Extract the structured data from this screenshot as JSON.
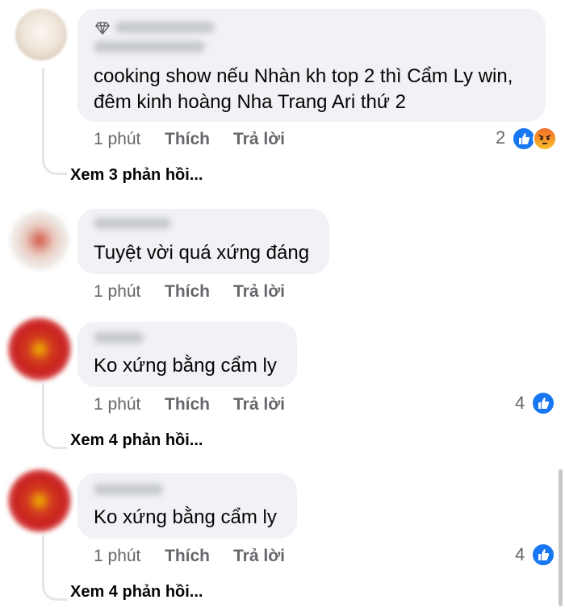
{
  "colors": {
    "like_blue": "#1877f2",
    "bubble_bg": "#f0f2f5",
    "meta_gray": "#65676b"
  },
  "comments": [
    {
      "text_lines": [
        "cooking show nếu Nhàn kh top 2 thì Cẩm Ly win,",
        "đêm kinh hoàng Nha Trang Ari thứ 2"
      ],
      "time": "1 phút",
      "like_label": "Thích",
      "reply_label": "Trả lời",
      "reaction_count": "2",
      "reactions": [
        "like-icon",
        "angry-icon"
      ],
      "view_replies": "Xem 3 phản hồi...",
      "badge": "diamond-icon"
    },
    {
      "text_lines": [
        "Tuyệt vời quá xứng đáng"
      ],
      "time": "1 phút",
      "like_label": "Thích",
      "reply_label": "Trả lời"
    },
    {
      "text_lines": [
        "Ko xứng bằng cẩm ly"
      ],
      "time": "1 phút",
      "like_label": "Thích",
      "reply_label": "Trả lời",
      "reaction_count": "4",
      "reactions": [
        "like-icon"
      ],
      "view_replies": "Xem 4 phản hồi..."
    },
    {
      "text_lines": [
        "Ko xứng bằng cẩm ly"
      ],
      "time": "1 phút",
      "like_label": "Thích",
      "reply_label": "Trả lời",
      "reaction_count": "4",
      "reactions": [
        "like-icon"
      ],
      "view_replies": "Xem 4 phản hồi..."
    }
  ]
}
